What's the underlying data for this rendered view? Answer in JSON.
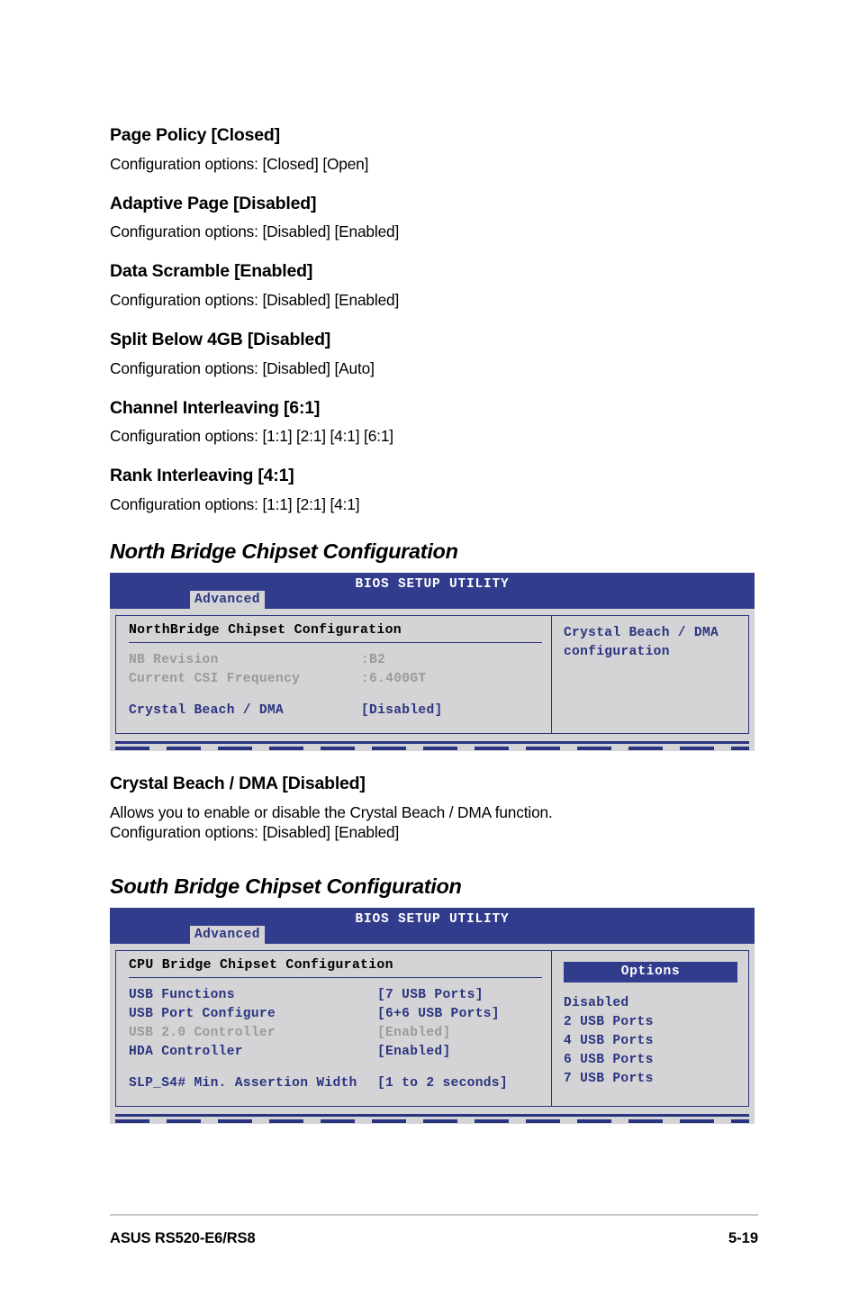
{
  "document": {
    "footer_left": "ASUS RS520-E6/RS8",
    "page_number": "5-19"
  },
  "options": [
    {
      "title": "Page Policy [Closed]",
      "body": "Configuration options: [Closed] [Open]"
    },
    {
      "title": "Adaptive Page [Disabled]",
      "body": "Configuration options: [Disabled] [Enabled]"
    },
    {
      "title": "Data Scramble [Enabled]",
      "body": "Configuration options: [Disabled] [Enabled]"
    },
    {
      "title": "Split Below 4GB [Disabled]",
      "body": "Configuration options: [Disabled] [Auto]"
    },
    {
      "title": "Channel Interleaving [6:1]",
      "body": "Configuration options: [1:1] [2:1] [4:1] [6:1]"
    },
    {
      "title": "Rank Interleaving [4:1]",
      "body": "Configuration options: [1:1] [2:1] [4:1]"
    }
  ],
  "section_north": {
    "heading": "North Bridge Chipset Configuration",
    "bios": {
      "title": "BIOS SETUP UTILITY",
      "tab": "Advanced",
      "section_heading": "NorthBridge Chipset Configuration",
      "rows": [
        {
          "key": "NB Revision",
          "value": ":B2",
          "style": "dim"
        },
        {
          "key": "Current CSI Frequency",
          "value": ":6.400GT",
          "style": "dim"
        }
      ],
      "active_row": {
        "key": "Crystal Beach / DMA",
        "value": "[Disabled]"
      },
      "help": "Crystal Beach / DMA configuration"
    }
  },
  "crystal_beach": {
    "title": "Crystal Beach / DMA [Disabled]",
    "body_line1": "Allows you to enable or disable the Crystal Beach / DMA function.",
    "body_line2": "Configuration options: [Disabled] [Enabled]"
  },
  "section_south": {
    "heading": "South Bridge Chipset Configuration",
    "bios": {
      "title": "BIOS SETUP UTILITY",
      "tab": "Advanced",
      "section_heading": "CPU Bridge Chipset Configuration",
      "rows": [
        {
          "key": "USB Functions",
          "value": "[7 USB Ports]",
          "style": "active"
        },
        {
          "key": "USB Port Configure",
          "value": "[6+6 USB Ports]",
          "style": "active"
        },
        {
          "key": "USB 2.0 Controller",
          "value": "[Enabled]",
          "style": "dim"
        },
        {
          "key": "HDA Controller",
          "value": "[Enabled]",
          "style": "active"
        }
      ],
      "last_row": {
        "key": "SLP_S4# Min. Assertion Width",
        "value": "[1 to 2 seconds]"
      },
      "options_header": "Options",
      "options": [
        "Disabled",
        "2 USB Ports",
        "4 USB Ports",
        "6 USB Ports",
        "7 USB Ports"
      ]
    }
  },
  "colors": {
    "bios_blue": "#313c8d",
    "bios_text_blue": "#2b3480",
    "bios_bg": "#d4d4d6",
    "bios_dim": "#9a9a9c"
  }
}
